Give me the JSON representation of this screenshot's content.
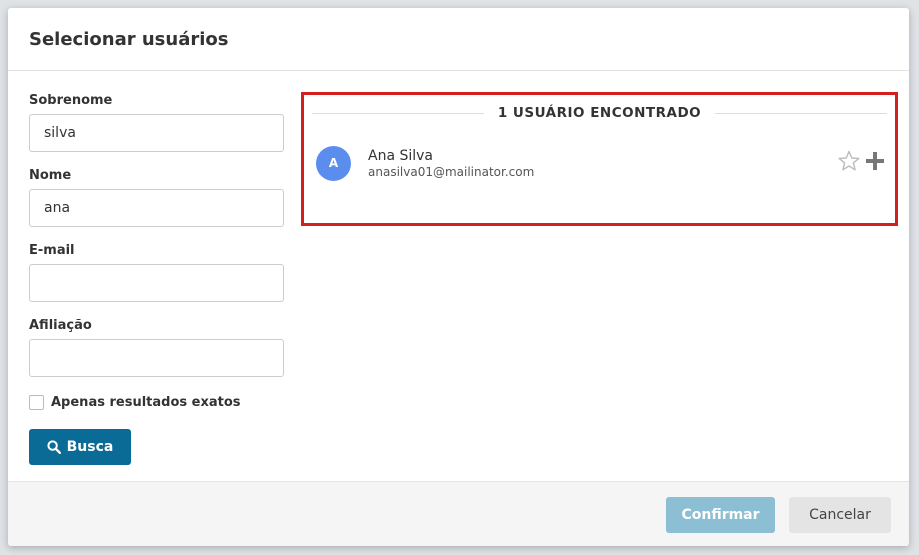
{
  "dialog": {
    "title": "Selecionar usuários"
  },
  "form": {
    "surname": {
      "label": "Sobrenome",
      "value": "silva"
    },
    "name": {
      "label": "Nome",
      "value": "ana"
    },
    "email": {
      "label": "E-mail",
      "value": ""
    },
    "affiliation": {
      "label": "Afiliação",
      "value": ""
    },
    "exact_only": {
      "label": "Apenas resultados exatos",
      "checked": false
    },
    "search_button": {
      "label": "Busca",
      "icon": "search-icon"
    }
  },
  "results": {
    "header": "1 USUÁRIO ENCONTRADO",
    "users": [
      {
        "initial": "A",
        "name": "Ana Silva",
        "email": "anasilva01@mailinator.com",
        "avatar_color": "#5b8def",
        "actions": [
          "star-icon",
          "plus-icon"
        ]
      }
    ],
    "highlight_color": "#d21f1f"
  },
  "footer": {
    "confirm_label": "Confirmar",
    "cancel_label": "Cancelar"
  },
  "colors": {
    "primary": "#0a6b96",
    "confirm_disabled": "#8dbfd4"
  }
}
